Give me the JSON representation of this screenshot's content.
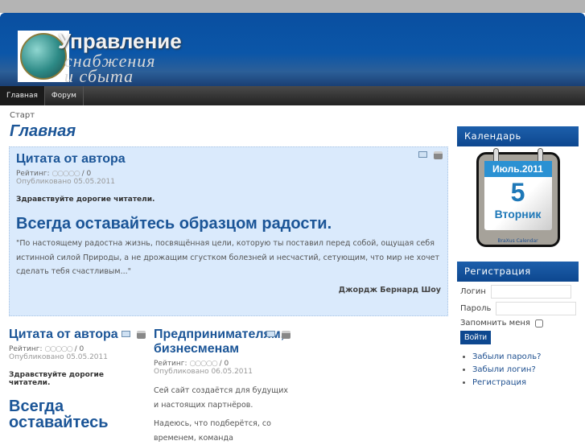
{
  "logo": {
    "line1": "Управление",
    "line2": "снабжения",
    "line3": "и сбыта"
  },
  "nav": [
    "Главная",
    "Форум"
  ],
  "breadcrumb": "Старт",
  "page_title": "Главная",
  "lead": {
    "title": "Цитата от автора",
    "rating_label": "Рейтинг:",
    "stars": "○○○○○",
    "rating_value": "/ 0",
    "published": "Опубликовано 05.05.2011",
    "greeting": "Здравствуйте дорогие читатели.",
    "headline": "Всегда оставайтесь образцом радости.",
    "quote": "\"По настоящему радостна жизнь, посвящённая цели, которую ты поставил перед собой, ощущая себя истинной силой Природы, а не дрожащим сгустком болезней и несчастий, сетующим, что мир не хочет сделать тебя счастливым...\"",
    "author": "Джордж Бернард Шоу"
  },
  "col1": {
    "title": "Цитата от автора",
    "rating_label": "Рейтинг:",
    "stars": "○○○○○",
    "rating_value": "/ 0",
    "published": "Опубликовано 05.05.2011",
    "greeting": "Здравствуйте дорогие читатели.",
    "headline": "Всегда оставайтесь"
  },
  "col2": {
    "title": "Предпринимателям, бизнесменам",
    "rating_label": "Рейтинг:",
    "stars": "○○○○○",
    "rating_value": "/ 0",
    "published": "Опубликовано 06.05.2011",
    "p1": "Сей сайт создаётся для будущих и настоящих партнёров.",
    "p2": "Надеюсь, что подберётся, со временем, команда"
  },
  "calendar": {
    "heading": "Календарь",
    "month": "Июль.2011",
    "day": "5",
    "weekday": "Вторник",
    "caption": "BraXus Calendar"
  },
  "login": {
    "heading": "Регистрация",
    "login_label": "Логин",
    "password_label": "Пароль",
    "remember_label": "Запомнить меня",
    "submit": "Войти",
    "links": [
      "Забыли пароль?",
      "Забыли логин?",
      "Регистрация"
    ]
  }
}
